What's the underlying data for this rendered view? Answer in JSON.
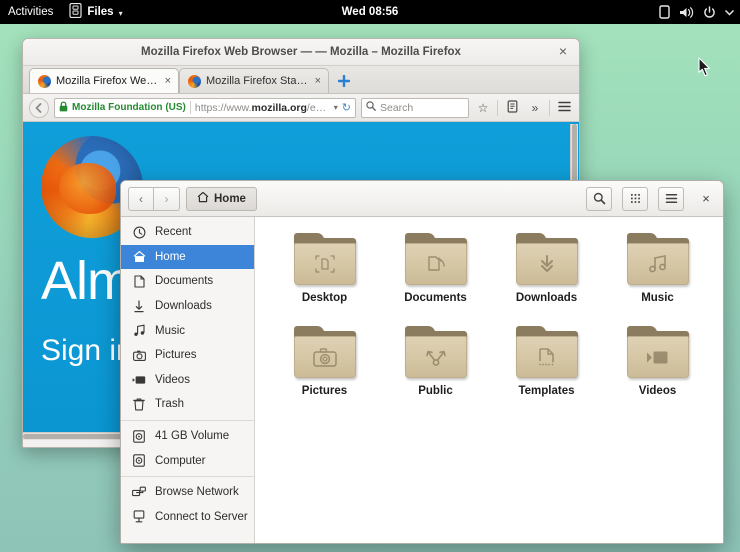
{
  "topbar": {
    "activities": "Activities",
    "app_name": "Files",
    "app_icon": "files-icon",
    "caret": "▾",
    "clock": "Wed 08:56",
    "tray": [
      {
        "name": "screen-icon"
      },
      {
        "name": "volume-icon"
      },
      {
        "name": "power-icon"
      },
      {
        "name": "chevron-down-icon"
      }
    ]
  },
  "firefox": {
    "title": "Mozilla Firefox Web Browser — — Mozilla – Mozilla Firefox",
    "close_label": "×",
    "tabs": [
      {
        "label": "Mozilla Firefox Web ...",
        "close": "×",
        "active": true
      },
      {
        "label": "Mozilla Firefox Start ...",
        "close": "×",
        "active": false
      }
    ],
    "new_tab_label": "+",
    "nav": {
      "back_label": "←",
      "identity": "Mozilla Foundation (US)",
      "url_prefix": "https://www.",
      "url_domain": "mozilla.org",
      "url_suffix": "/en-US",
      "url_chevron": "▾",
      "reload_label": "↻",
      "search_placeholder": "Search",
      "bookmark_label": "☆",
      "library_label": "☰",
      "overflow_label": "»",
      "menu_label": "☰"
    },
    "page": {
      "headline": "Almost there",
      "signin": "Sign in"
    }
  },
  "files": {
    "back_label": "‹",
    "forward_label": "›",
    "breadcrumb": "Home",
    "breadcrumb_icon": "home-icon",
    "buttons": [
      {
        "name": "search-button",
        "label": "search-icon"
      },
      {
        "name": "view-grid-button",
        "label": "grid-icon"
      },
      {
        "name": "menu-button",
        "label": "hamburger-icon"
      }
    ],
    "close_label": "×",
    "sidebar": [
      {
        "label": "Recent",
        "icon": "clock-icon",
        "selected": false,
        "sep_after": false
      },
      {
        "label": "Home",
        "icon": "home-icon",
        "selected": true,
        "sep_after": false
      },
      {
        "label": "Documents",
        "icon": "document-icon",
        "selected": false,
        "sep_after": false
      },
      {
        "label": "Downloads",
        "icon": "download-icon",
        "selected": false,
        "sep_after": false
      },
      {
        "label": "Music",
        "icon": "music-icon",
        "selected": false,
        "sep_after": false
      },
      {
        "label": "Pictures",
        "icon": "camera-icon",
        "selected": false,
        "sep_after": false
      },
      {
        "label": "Videos",
        "icon": "video-icon",
        "selected": false,
        "sep_after": false
      },
      {
        "label": "Trash",
        "icon": "trash-icon",
        "selected": false,
        "sep_after": true
      },
      {
        "label": "41 GB Volume",
        "icon": "drive-icon",
        "selected": false,
        "sep_after": false
      },
      {
        "label": "Computer",
        "icon": "drive-icon",
        "selected": false,
        "sep_after": true
      },
      {
        "label": "Browse Network",
        "icon": "network-icon",
        "selected": false,
        "sep_after": false
      },
      {
        "label": "Connect to Server",
        "icon": "server-icon",
        "selected": false,
        "sep_after": false
      }
    ],
    "items": [
      {
        "label": "Desktop",
        "glyph": "desktop-emblem"
      },
      {
        "label": "Documents",
        "glyph": "documents-emblem"
      },
      {
        "label": "Downloads",
        "glyph": "downloads-emblem"
      },
      {
        "label": "Music",
        "glyph": "music-emblem"
      },
      {
        "label": "Pictures",
        "glyph": "pictures-emblem"
      },
      {
        "label": "Public",
        "glyph": "public-emblem"
      },
      {
        "label": "Templates",
        "glyph": "templates-emblem"
      },
      {
        "label": "Videos",
        "glyph": "videos-emblem"
      }
    ]
  },
  "colors": {
    "selection_blue": "#3c85d8",
    "firefox_page_blue": "#0f9ed9",
    "desktop_green_top": "#a4e3bb",
    "desktop_green_bottom": "#8ec4b8",
    "folder_tan": "#d5c6a4",
    "folder_tab_brown": "#8c7c5f",
    "identity_green": "#238c30"
  }
}
